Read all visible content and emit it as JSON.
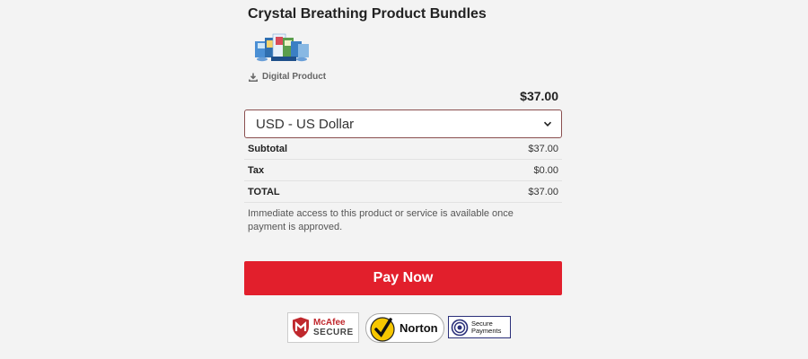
{
  "product": {
    "title": "Crystal Breathing Product Bundles",
    "image_icon": "product-bundle-image",
    "type_label": "Digital Product",
    "type_icon": "download-icon",
    "price": "$37.00"
  },
  "currency": {
    "selected": "USD - US Dollar",
    "icon": "chevron-down-icon"
  },
  "summary": [
    {
      "label": "Subtotal",
      "amount": "$37.00"
    },
    {
      "label": "Tax",
      "amount": "$0.00"
    },
    {
      "label": "TOTAL",
      "amount": "$37.00"
    }
  ],
  "note": "Immediate access to this product or service is available once payment is approved.",
  "pay_button": {
    "label": "Pay Now",
    "color": "#e21f2c"
  },
  "trust_badges": [
    {
      "name": "McAfee",
      "line1": "McAfee",
      "line2": "SECURE"
    },
    {
      "name": "Norton",
      "line1": "Norton"
    },
    {
      "name": "Secure Payments",
      "line1": "Secure",
      "line2": "Payments"
    }
  ]
}
